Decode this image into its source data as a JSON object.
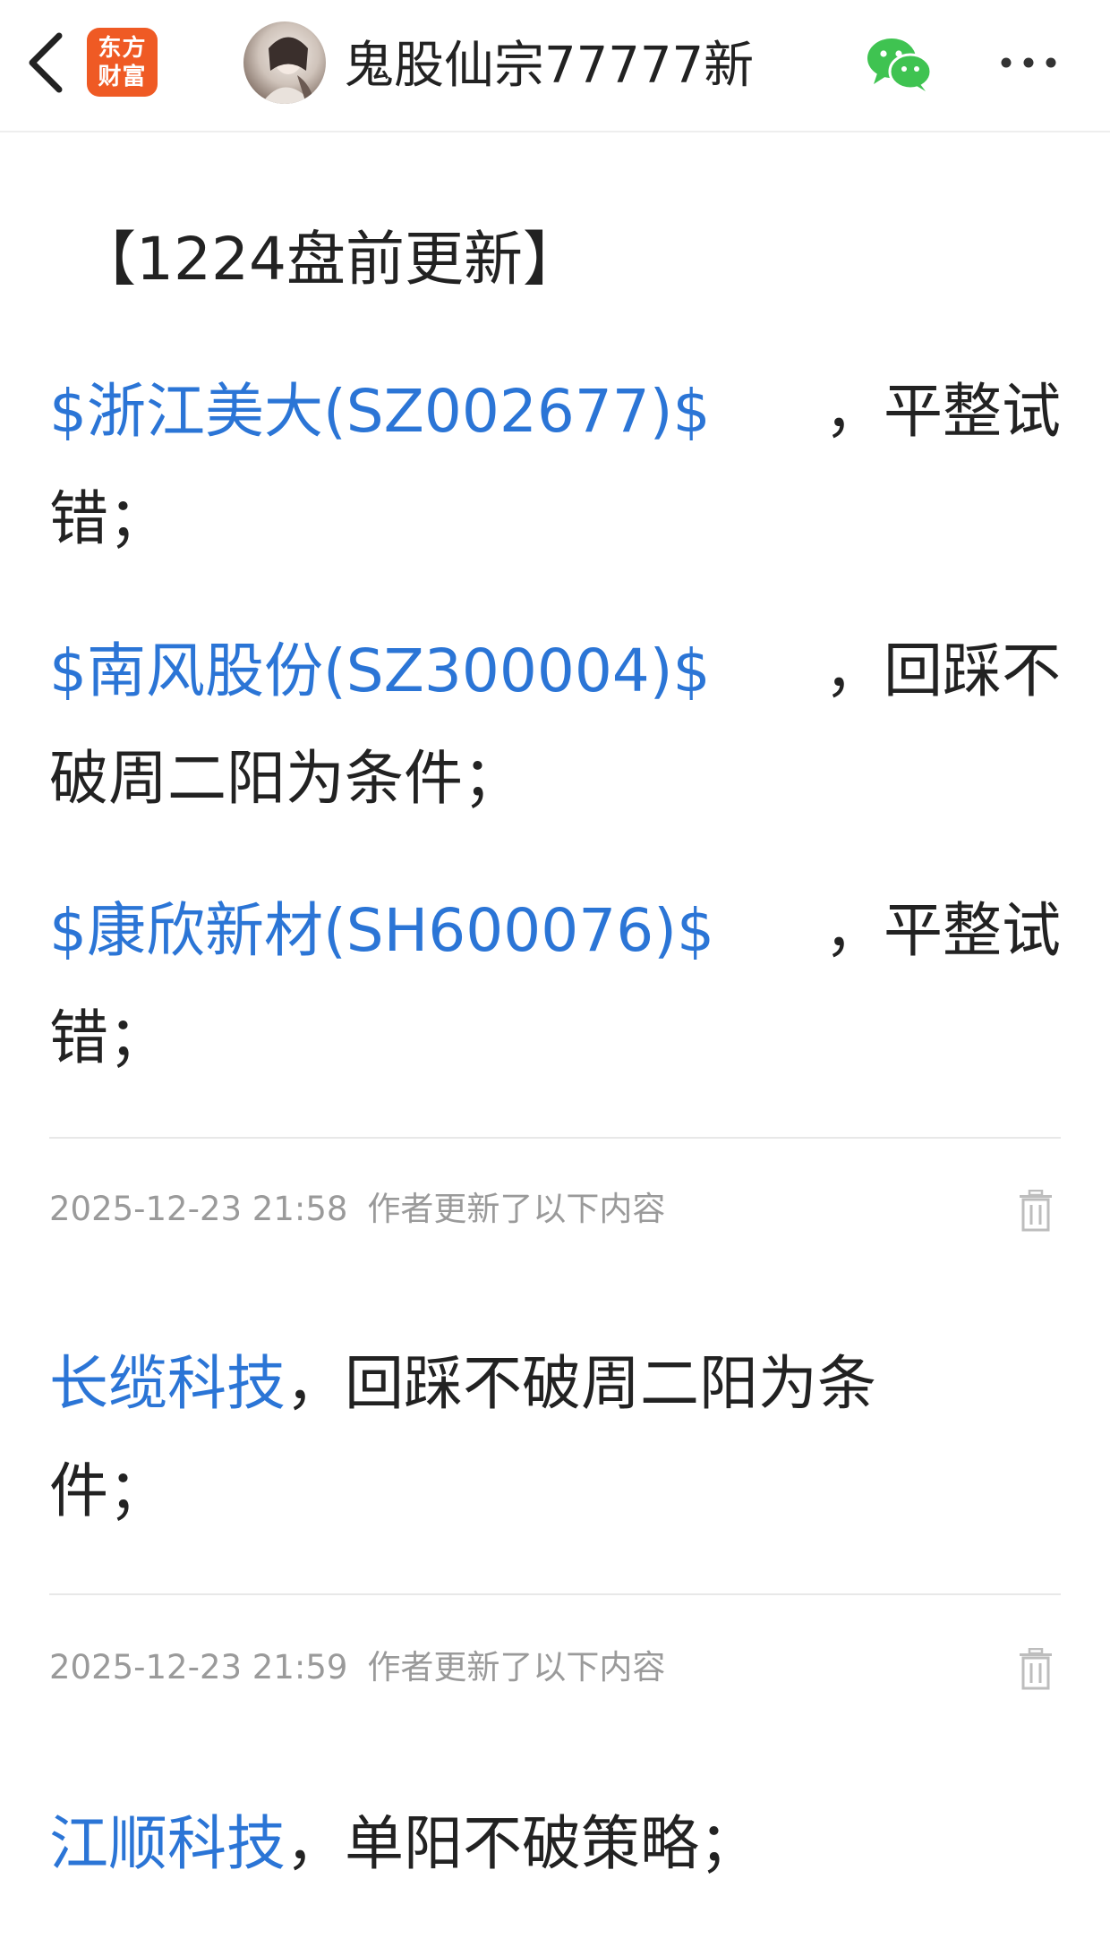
{
  "header": {
    "title": "鬼股仙宗77777新",
    "logo_line1": "东方",
    "logo_line2": "财富",
    "icons": [
      "back-icon",
      "wechat-icon",
      "more-icon"
    ]
  },
  "post": {
    "title": "【1224盘前更新】",
    "items": [
      {
        "stock": "$浙江美大(SZ002677)$",
        "sep": "，",
        "text_line1_rest": "平整试",
        "text_line2": "错；"
      },
      {
        "stock": "$南风股份(SZ300004)$",
        "sep": "，",
        "text_line1_rest": "回踩不",
        "text_line2": "破周二阳为条件；"
      },
      {
        "stock": "$康欣新材(SH600076)$",
        "sep": "，",
        "text_line1_rest": "平整试",
        "text_line2": "错；"
      }
    ]
  },
  "updates": [
    {
      "timestamp": "2025-12-23 21:58",
      "label": "作者更新了以下内容",
      "stock": "长缆科技",
      "text_line1": "，回踩不破周二阳为条",
      "text_line2": "件；"
    },
    {
      "timestamp": "2025-12-23 21:59",
      "label": "作者更新了以下内容",
      "stock": "江顺科技",
      "text_line1": "，单阳不破策略；"
    }
  ],
  "colors": {
    "link": "#2b75d6",
    "logo_bg": "#ef5a24",
    "wechat": "#3fc351",
    "muted": "#9a9a9a"
  }
}
